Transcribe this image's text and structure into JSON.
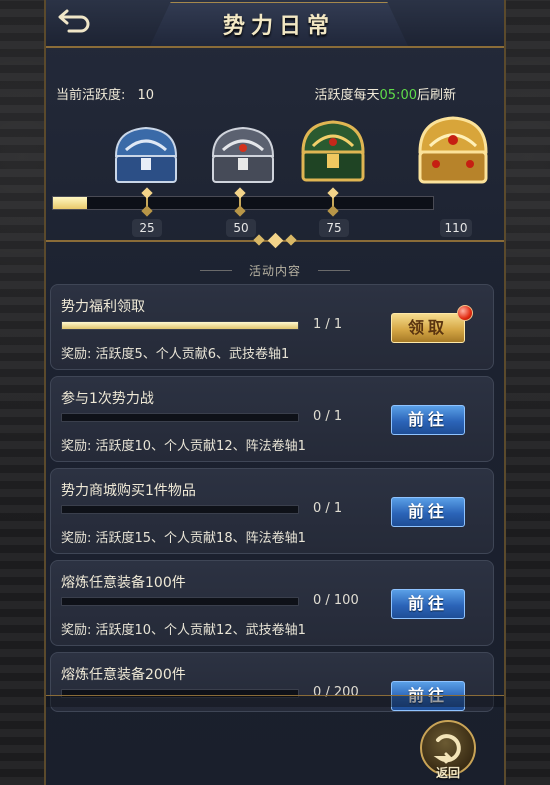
{
  "header": {
    "title": "势力日常"
  },
  "activity": {
    "current_label": "当前活跃度:",
    "current_value": "10",
    "refresh_prefix": "活跃度每天",
    "refresh_time": "05:00",
    "refresh_suffix": "后刷新",
    "progress_fraction": 0.09,
    "milestones": [
      "25",
      "50",
      "75",
      "110"
    ]
  },
  "section_title": "活动内容",
  "tasks": [
    {
      "title": "势力福利领取",
      "count": "1 / 1",
      "reward": "奖励: 活跃度5、个人贡献6、武技卷轴1",
      "button": "领取",
      "progress": 1.0
    },
    {
      "title": "参与1次势力战",
      "count": "0 / 1",
      "reward": "奖励: 活跃度10、个人贡献12、阵法卷轴1",
      "button": "前往",
      "progress": 0
    },
    {
      "title": "势力商城购买1件物品",
      "count": "0 / 1",
      "reward": "奖励: 活跃度15、个人贡献18、阵法卷轴1",
      "button": "前往",
      "progress": 0
    },
    {
      "title": "熔炼任意装备100件",
      "count": "0 / 100",
      "reward": "奖励: 活跃度10、个人贡献12、武技卷轴1",
      "button": "前往",
      "progress": 0
    },
    {
      "title": "熔炼任意装备200件",
      "count": "0 / 200",
      "reward": "",
      "button": "前往",
      "progress": 0
    }
  ],
  "return_label": "返回",
  "colors": {
    "accent_gold": "#c9a457",
    "refresh_time_green": "#5fdc4a",
    "go_button_blue": "#2b64b8",
    "claim_button_gold": "#d6a846"
  }
}
